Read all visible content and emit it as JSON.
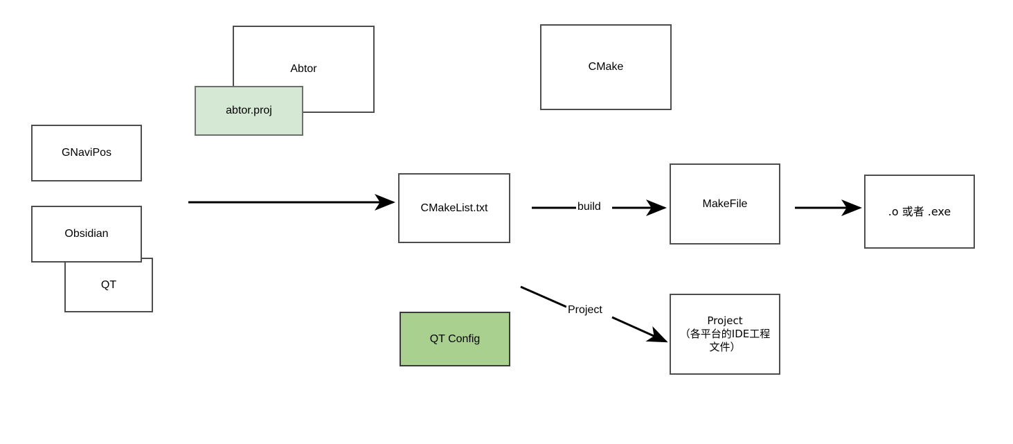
{
  "diagram": {
    "title": "Build toolchain flow diagram",
    "background": "#ffffff",
    "colors": {
      "box_border": "#555555",
      "box_fill": "#ffffff",
      "green_light_fill": "#d5e8d4",
      "green_light_border": "#6e6e6e",
      "green_mid_fill": "#a9d08e",
      "green_mid_border": "#3a3a3a",
      "arrow": "#000000",
      "text": "#000000"
    },
    "nodes": {
      "gnavipos": {
        "label": "GNaviPos"
      },
      "obsidian": {
        "label": "Obsidian"
      },
      "qt": {
        "label": "QT"
      },
      "abtor": {
        "label": "Abtor"
      },
      "abtor_proj": {
        "label": "abtor.proj"
      },
      "cmake": {
        "label": "CMake"
      },
      "cmakelist": {
        "label": "CMakeList.txt"
      },
      "makefile": {
        "label": "MakeFile"
      },
      "output": {
        "label": ".o 或者 .exe"
      },
      "qt_config": {
        "label": "QT Config"
      },
      "project": {
        "label": "Project\n（各平台的IDE工程文件）"
      }
    },
    "edges": {
      "sources_to_cmakelist": {
        "label": ""
      },
      "cmakelist_to_makefile": {
        "label": "build"
      },
      "makefile_to_output": {
        "label": ""
      },
      "cmakelist_to_project": {
        "label": "Project"
      }
    }
  }
}
